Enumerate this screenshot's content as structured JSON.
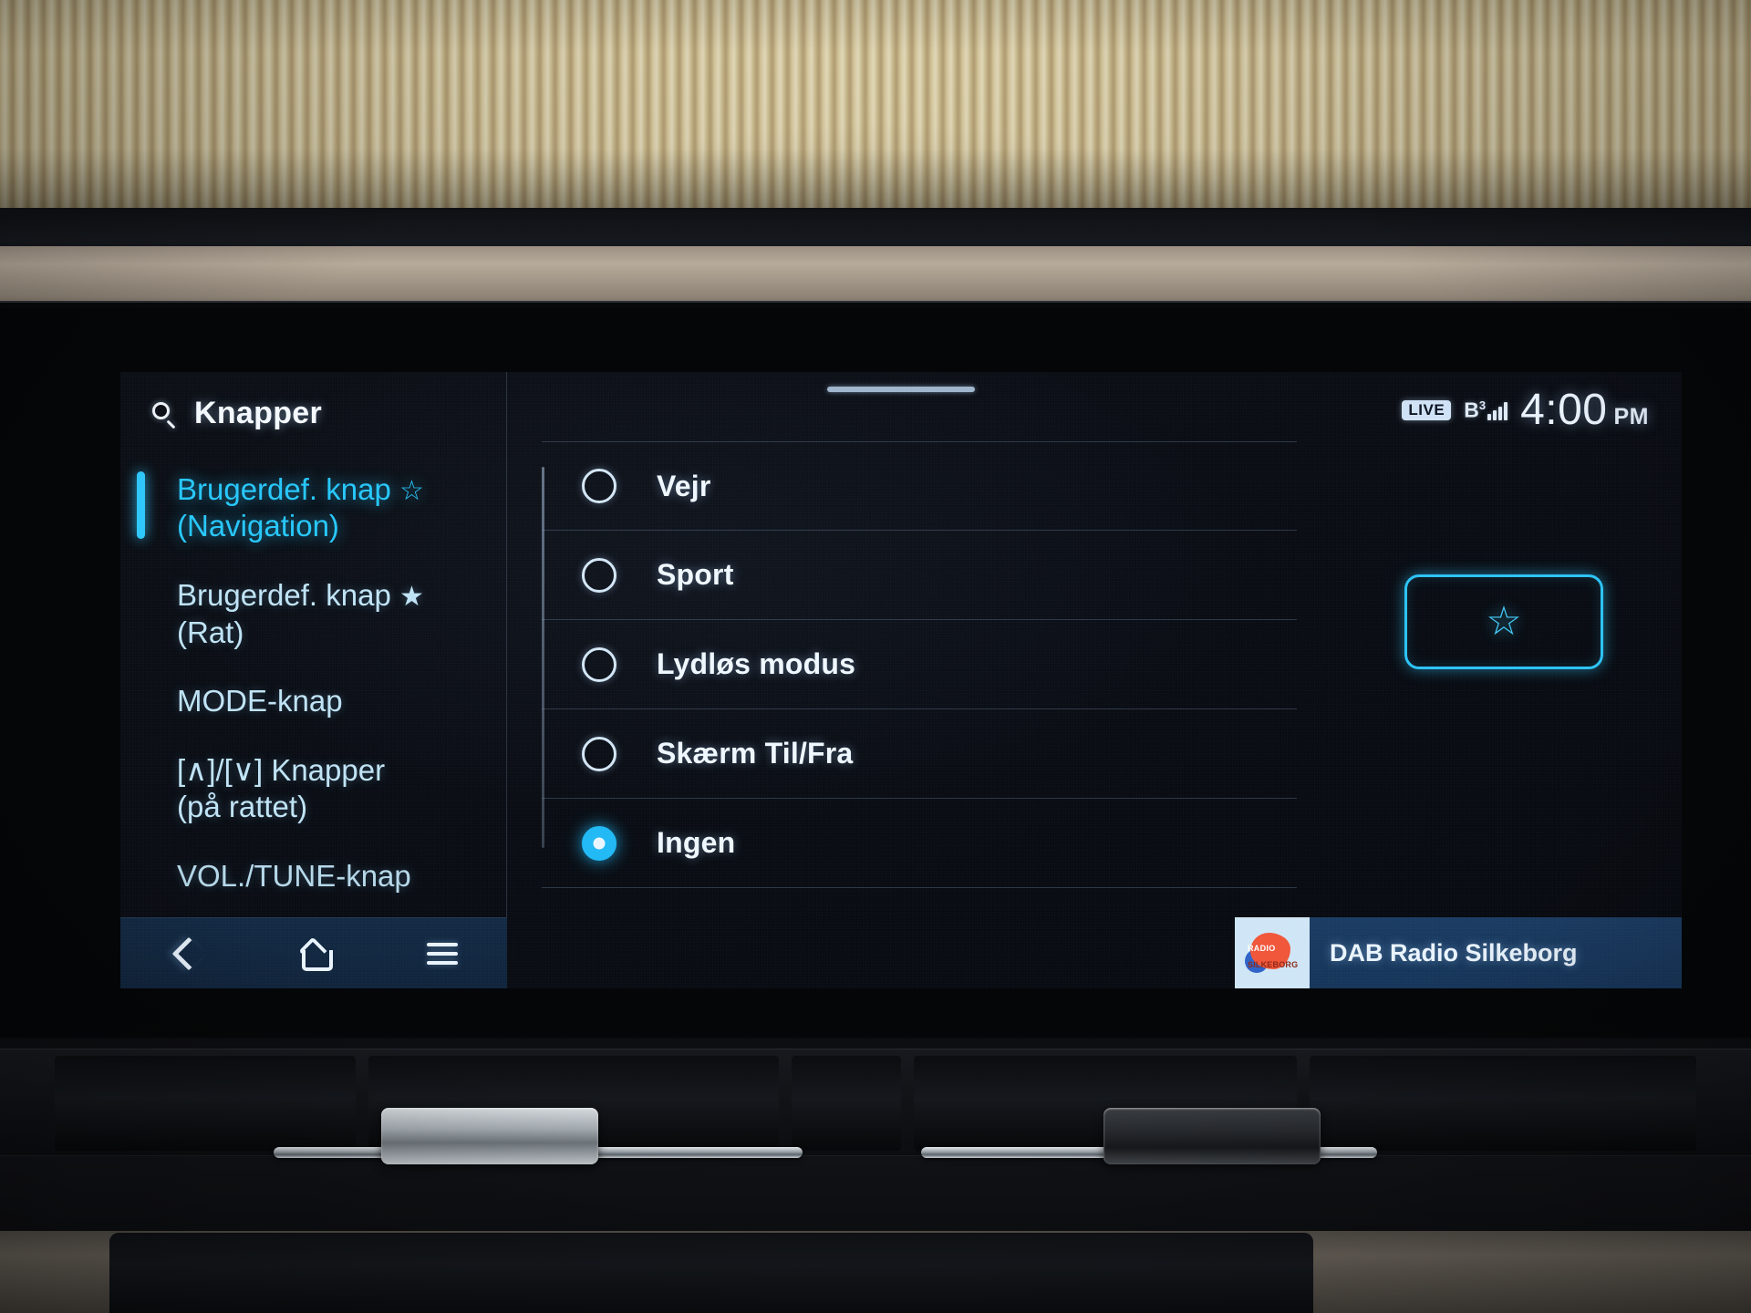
{
  "status_bar": {
    "live_badge": "LIVE",
    "signal_label": "B",
    "signal_superscript": "3",
    "time": "4:00",
    "meridiem": "PM"
  },
  "search": {
    "icon": "search-icon",
    "title": "Knapper"
  },
  "sidebar": {
    "items": [
      {
        "label": "Brugerdef. knap",
        "star": "☆",
        "sub": "(Navigation)",
        "active": true
      },
      {
        "label": "Brugerdef. knap",
        "star": "★",
        "sub": "(Rat)",
        "active": false
      },
      {
        "label": "MODE-knap",
        "star": "",
        "sub": "",
        "active": false
      },
      {
        "label": "[∧]/[∨] Knapper",
        "star": "",
        "sub": "(på rattet)",
        "active": false
      },
      {
        "label": "VOL./TUNE-knap",
        "star": "",
        "sub": "",
        "active": false
      }
    ]
  },
  "nav_bar": {
    "back": "back-icon",
    "home": "home-icon",
    "menu": "menu-icon"
  },
  "options": {
    "items": [
      {
        "label": "Vejr",
        "selected": false
      },
      {
        "label": "Sport",
        "selected": false
      },
      {
        "label": "Lydløs modus",
        "selected": false
      },
      {
        "label": "Skærm Til/Fra",
        "selected": false
      },
      {
        "label": "Ingen",
        "selected": true
      }
    ]
  },
  "key_preview": {
    "icon": "☆"
  },
  "now_playing": {
    "title": "DAB Radio Silkeborg",
    "logo_primary": "RADIO",
    "logo_secondary": "SILKEBORG"
  },
  "colors": {
    "accent": "#27c7fb",
    "selected_radio": "#21b9f5",
    "text_primary": "#eff7ff",
    "sidebar_text": "#bfe3f5",
    "now_playing_bg": "#1b3c63"
  }
}
